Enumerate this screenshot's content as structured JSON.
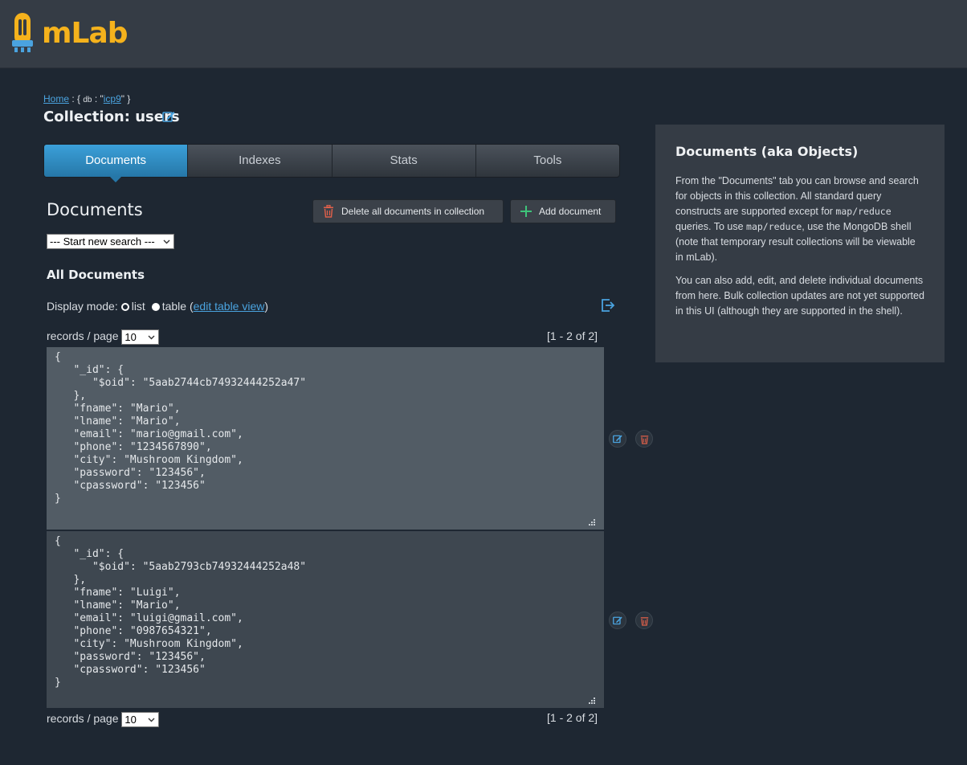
{
  "brand": {
    "name_m": "m",
    "name_lab": "Lab",
    "accent": "#f5b21c"
  },
  "breadcrumb": {
    "home": "Home",
    "sep": " : { ",
    "db_key": "db",
    "db_mid": " : \"",
    "db_name": "icp9",
    "end": "\" }"
  },
  "page": {
    "title": "Collection: users"
  },
  "tabs": [
    {
      "label": "Documents",
      "active": true
    },
    {
      "label": "Indexes"
    },
    {
      "label": "Stats"
    },
    {
      "label": "Tools"
    }
  ],
  "documents": {
    "heading": "Documents",
    "delete_all_label": "Delete all documents in collection",
    "add_label": "Add document",
    "search_select": "--- Start new search ---",
    "all_docs_heading": "All Documents",
    "display_mode_label": "Display mode:",
    "mode_list": "list",
    "mode_table": "table",
    "edit_table_view_pre": "(",
    "edit_table_view": "edit table view",
    "edit_table_view_post": ")",
    "records_per_page_label": "records / page",
    "records_per_page_value": "10",
    "range": "[1 - 2 of 2]"
  },
  "records": [
    {
      "json": "{\n   \"_id\": {\n      \"$oid\": \"5aab2744cb74932444252a47\"\n   },\n   \"fname\": \"Mario\",\n   \"lname\": \"Mario\",\n   \"email\": \"mario@gmail.com\",\n   \"phone\": \"1234567890\",\n   \"city\": \"Mushroom Kingdom\",\n   \"password\": \"123456\",\n   \"cpassword\": \"123456\"\n}"
    },
    {
      "json": "{\n   \"_id\": {\n      \"$oid\": \"5aab2793cb74932444252a48\"\n   },\n   \"fname\": \"Luigi\",\n   \"lname\": \"Mario\",\n   \"email\": \"luigi@gmail.com\",\n   \"phone\": \"0987654321\",\n   \"city\": \"Mushroom Kingdom\",\n   \"password\": \"123456\",\n   \"cpassword\": \"123456\"\n}"
    }
  ],
  "sidebar": {
    "title": "Documents (aka Objects)",
    "p1_a": "From the \"Documents\" tab you can browse and search for objects in this collection. All standard query constructs are supported except for ",
    "p1_code1": "map/reduce",
    "p1_b": " queries. To use ",
    "p1_code2": "map/reduce",
    "p1_c": ", use the MongoDB shell (note that temporary result collections will be viewable in mLab).",
    "p2": "You can also add, edit, and delete individual documents from here. Bulk collection updates are not yet supported in this UI (although they are supported in the shell)."
  },
  "colors": {
    "background": "#1e2732",
    "topbar": "#353c45",
    "tab_active": "#3ba0d9",
    "link": "#4aa3df",
    "delete": "#e0604a",
    "add": "#3ec47a"
  }
}
